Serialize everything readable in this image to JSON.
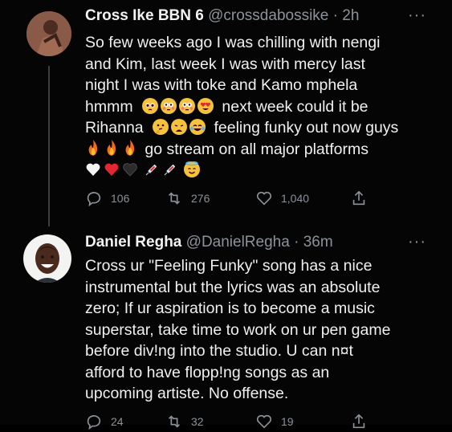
{
  "tweet1": {
    "display_name": "Cross Ike BBN 6",
    "handle": "@crossdabossike",
    "separator": "·",
    "time": "2h",
    "more": "···",
    "lines": [
      "So few weeks ago I was chilling with nengi",
      "and Kim, last week I was with mercy last",
      "night I was with toke and Kamo mphela",
      "hmmm",
      "next week could it be",
      "Rihanna",
      "feeling funky out now guys",
      "go stream on all major platforms"
    ],
    "emojis": {
      "row4": [
        "pleading-face",
        "flushed-face",
        "flushed-face",
        "heart-eyes-face"
      ],
      "row5": [
        "thinking-face",
        "weary-face",
        "tears-of-joy-face"
      ],
      "row6": [
        "fire",
        "fire",
        "fire"
      ],
      "row7": [
        "white-heart",
        "red-heart",
        "black-heart",
        "syringe",
        "syringe",
        "smiling-face-with-halo"
      ]
    },
    "actions": {
      "replies": "106",
      "retweets": "276",
      "likes": "1,040"
    }
  },
  "tweet2": {
    "display_name": "Daniel Regha",
    "handle": "@DanielRegha",
    "separator": "·",
    "time": "36m",
    "more": "···",
    "lines": [
      "Cross ur \"Feeling Funky\" song has a nice",
      "instrumental but the lyrics was an absolute",
      "zero; If ur aspiration is to become a  music",
      "superstar, take time to work on ur pen game",
      "before div!ng into the studio. U can n¤t",
      "afford to have flopp!ng songs as an",
      "upcoming artiste. No offense."
    ],
    "actions": {
      "replies": "24",
      "retweets": "32",
      "likes": "19"
    }
  },
  "colors": {
    "background": "#050505",
    "text": "#f0f0f0",
    "muted": "#8b9299"
  }
}
